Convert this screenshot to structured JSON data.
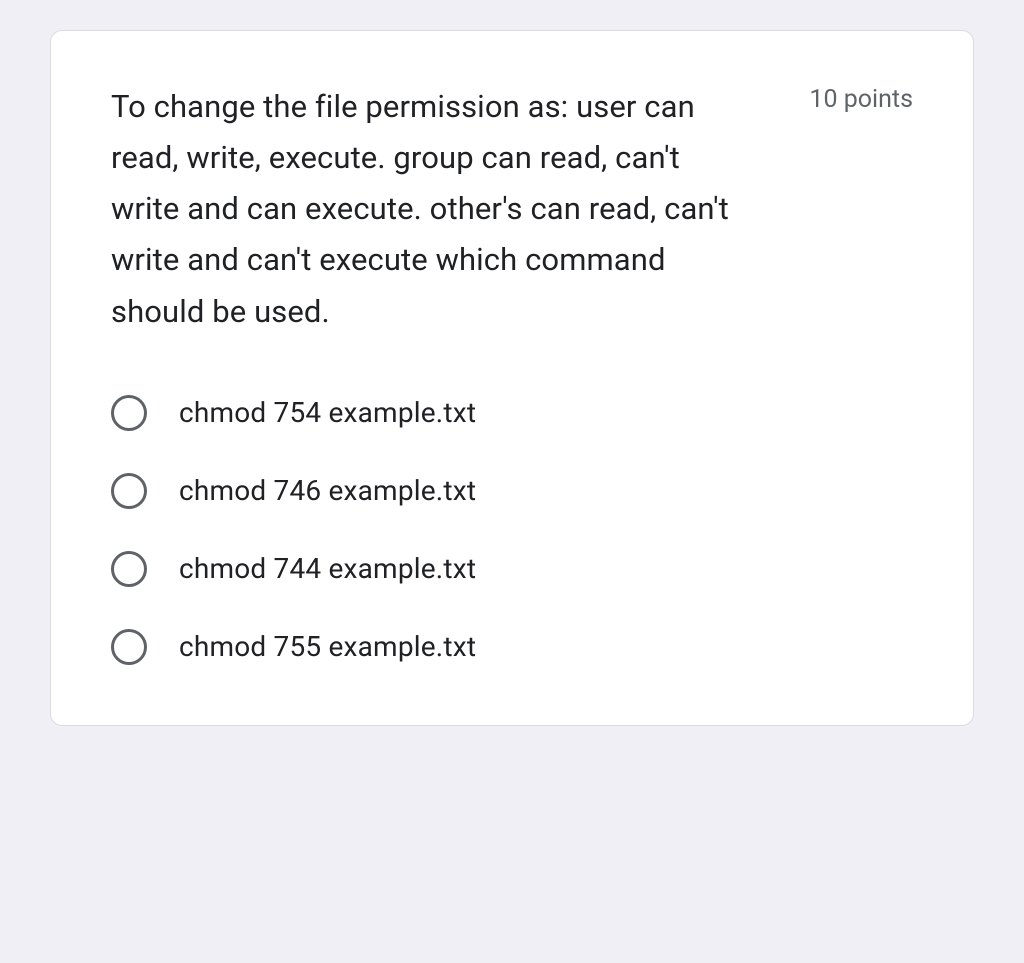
{
  "question": {
    "text": "To change the file permission as: user can read, write, execute. group can read, can't write and can execute. other's can read, can't write and can't execute which command should be used.",
    "points_label": "10 points"
  },
  "options": [
    {
      "label": "chmod 754 example.txt"
    },
    {
      "label": "chmod 746 example.txt"
    },
    {
      "label": "chmod 744 example.txt"
    },
    {
      "label": "chmod 755 example.txt"
    }
  ]
}
